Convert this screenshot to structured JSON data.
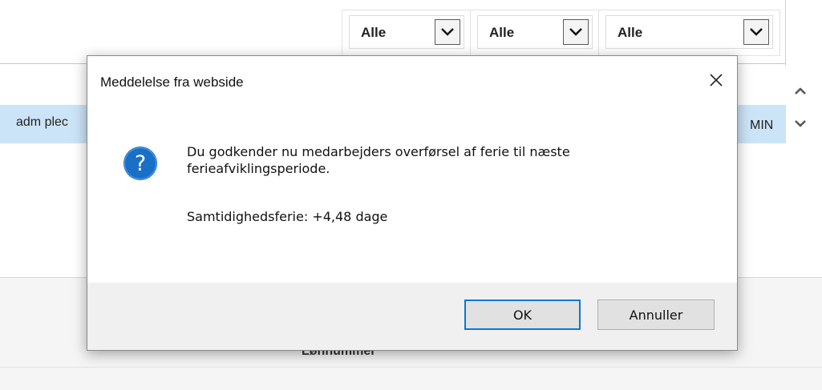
{
  "background": {
    "filters": [
      {
        "value": "Alle"
      },
      {
        "value": "Alle"
      },
      {
        "value": "Alle"
      }
    ],
    "selected_row": {
      "left_text": "adm plec",
      "right_text": "MIN"
    },
    "lower_label": "Lønnummer"
  },
  "dialog": {
    "title": "Meddelelse fra webside",
    "icon": "question-icon",
    "message": "Du godkender nu medarbejders overførsel af ferie til  næste ferieafviklingsperiode.",
    "detail": "Samtidighedsferie: +4,48  dage",
    "buttons": {
      "ok_label": "OK",
      "cancel_label": "Annuller"
    }
  },
  "colors": {
    "selected_row": "#cce4f7",
    "icon_blue": "#1a6fc7",
    "focus_border": "#0a78d7"
  }
}
